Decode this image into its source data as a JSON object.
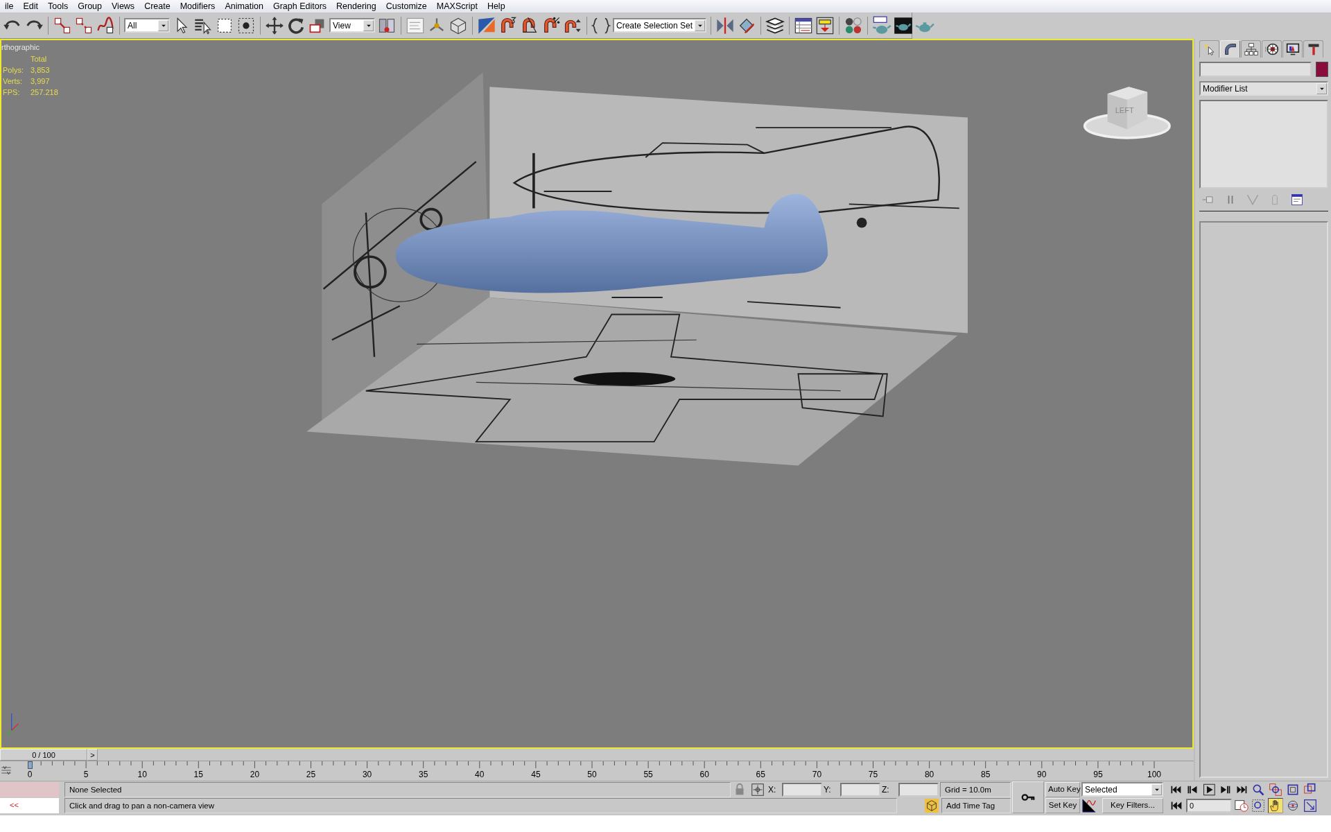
{
  "menu_bar": [
    {
      "label": "ile"
    },
    {
      "label": "Edit"
    },
    {
      "label": "Tools"
    },
    {
      "label": "Group"
    },
    {
      "label": "Views"
    },
    {
      "label": "Create"
    },
    {
      "label": "Modifiers"
    },
    {
      "label": "Animation"
    },
    {
      "label": "Graph Editors"
    },
    {
      "label": "Rendering"
    },
    {
      "label": "Customize"
    },
    {
      "label": "MAXScript"
    },
    {
      "label": "Help"
    }
  ],
  "toolbar": {
    "selection_filter": "All",
    "reference_coordinate": "View",
    "named_selection_set": "Create Selection Set"
  },
  "viewport": {
    "label": "rthographic",
    "active": true,
    "stats_header": "Total",
    "stats": [
      {
        "label": "Polys:",
        "value": "3,853"
      },
      {
        "label": "Verts:",
        "value": "3,997"
      },
      {
        "label": "FPS:",
        "value": "257.218"
      }
    ],
    "viewcube_label": "LEFT"
  },
  "command_panel": {
    "tabs": [
      {
        "selected": false
      },
      {
        "selected": true
      },
      {
        "selected": false
      },
      {
        "selected": false
      },
      {
        "selected": false
      },
      {
        "selected": false
      }
    ],
    "modifier_list": "Modifier List"
  },
  "time_slider": {
    "frame": "0 / 100",
    "next": ">"
  },
  "track_bar": {
    "ticks": [
      "0",
      "5",
      "10",
      "15",
      "20",
      "25",
      "30",
      "35",
      "40",
      "45",
      "50",
      "55",
      "60",
      "65",
      "70",
      "75",
      "80",
      "85",
      "90",
      "95",
      "100"
    ]
  },
  "status_bar": {
    "listener": "<<",
    "selection": "None Selected",
    "prompt": "Click and drag to pan a non-camera view",
    "x_label": "X:",
    "y_label": "Y:",
    "z_label": "Z:",
    "grid": "Grid = 10.0m",
    "add_time_tag": "Add Time Tag",
    "auto_key": "Auto Key",
    "set_key": "Set Key",
    "key_mode": "Selected",
    "key_filters": "Key Filters...",
    "current_frame": "0",
    "nav_buttons": [
      {
        "selected": false
      },
      {
        "selected": false
      },
      {
        "selected": false
      },
      {
        "selected": false
      },
      {
        "selected": false
      },
      {
        "selected": true
      },
      {
        "selected": false
      },
      {
        "selected": false
      }
    ]
  }
}
